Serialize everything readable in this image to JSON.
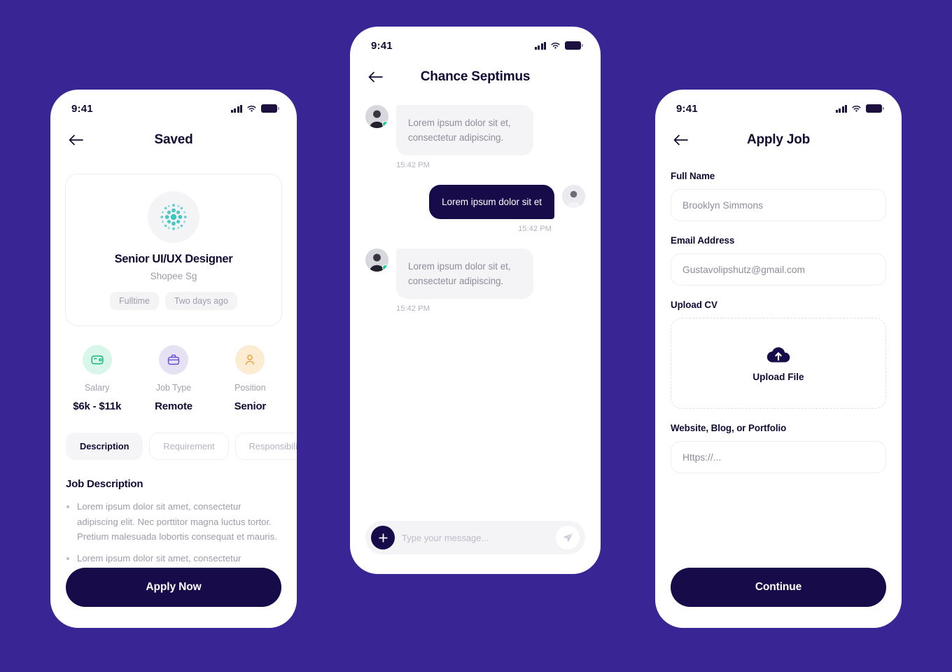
{
  "background_color": "#3A2594",
  "accent_dark": "#170b4a",
  "screens": {
    "saved": {
      "status": {
        "time": "9:41"
      },
      "nav": {
        "title": "Saved",
        "back_icon": "arrow-left-icon"
      },
      "job": {
        "logo_icon": "company-logo-dots-icon",
        "title": "Senior UI/UX Designer",
        "company": "Shopee Sg",
        "pills": [
          "Fulltime",
          "Two days ago"
        ]
      },
      "facts": [
        {
          "icon": "wallet-icon",
          "label": "Salary",
          "value": "$6k - $11k",
          "color": "#d9f6ea"
        },
        {
          "icon": "briefcase-icon",
          "label": "Job Type",
          "value": "Remote",
          "color": "#e6e2f3"
        },
        {
          "icon": "person-icon",
          "label": "Position",
          "value": "Senior",
          "color": "#fdecd4"
        }
      ],
      "tabs": [
        {
          "label": "Description",
          "active": true
        },
        {
          "label": "Requirement",
          "active": false
        },
        {
          "label": "Responsibilities",
          "active": false
        }
      ],
      "description_heading": "Job Description",
      "description_items": [
        "Lorem ipsum dolor sit amet, consectetur adipiscing elit. Nec porttitor magna luctus tortor. Pretium malesuada lobortis consequat et mauris.",
        "Lorem ipsum dolor sit amet, consectetur adipiscing elit. Nec porttitor magna luctus"
      ],
      "cta_label": "Apply Now"
    },
    "chat": {
      "status": {
        "time": "9:41"
      },
      "nav": {
        "title": "Chance Septimus",
        "back_icon": "arrow-left-icon"
      },
      "messages": [
        {
          "side": "in",
          "text": "Lorem ipsum dolor sit et, consectetur adipiscing.",
          "time": "15:42 PM",
          "online": true
        },
        {
          "side": "out",
          "text": "Lorem ipsum dolor sit et",
          "time": "15:42 PM",
          "online": false
        },
        {
          "side": "in",
          "text": "Lorem ipsum dolor sit et, consectetur adipiscing.",
          "time": "15:42 PM",
          "online": true
        }
      ],
      "composer": {
        "add_icon": "plus-icon",
        "placeholder": "Type your message...",
        "value": "",
        "send_icon": "send-paper-plane-icon"
      }
    },
    "apply": {
      "status": {
        "time": "9:41"
      },
      "nav": {
        "title": "Apply Job",
        "back_icon": "arrow-left-icon"
      },
      "fields": {
        "full_name": {
          "label": "Full Name",
          "placeholder": "Brooklyn Simmons",
          "value": ""
        },
        "email": {
          "label": "Email Address",
          "placeholder": "Gustavolipshutz@gmail.com",
          "value": ""
        },
        "upload_cv": {
          "label": "Upload CV",
          "dropzone_label": "Upload File",
          "icon": "cloud-upload-icon"
        },
        "portfolio": {
          "label": "Website, Blog, or Portfolio",
          "placeholder": "Https://...",
          "value": ""
        }
      },
      "cta_label": "Continue"
    }
  }
}
